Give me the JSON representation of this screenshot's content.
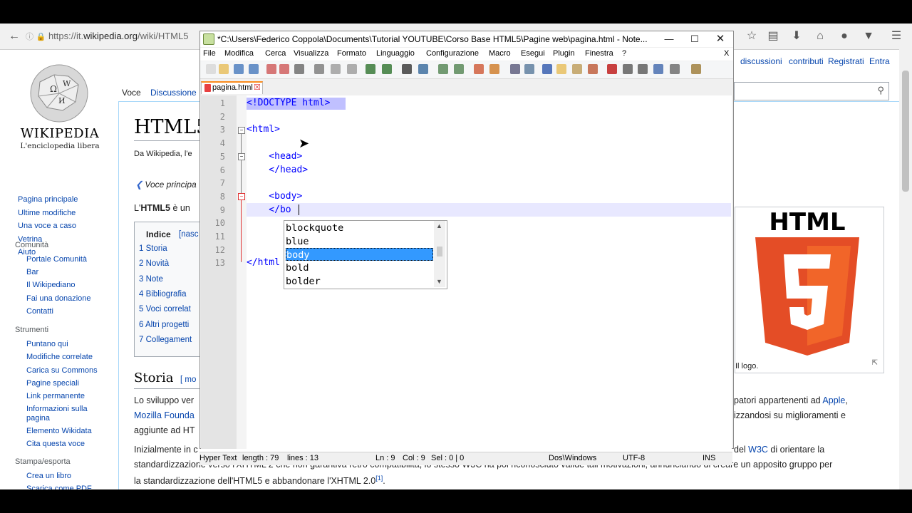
{
  "browser": {
    "url_prefix": "https://it.",
    "url_domain": "wikipedia.org",
    "url_path": "/wiki/HTML5"
  },
  "wiki": {
    "wordmark": "WIKIPEDIA",
    "tagline": "L'enciclopedia libera",
    "tabs": [
      "Voce",
      "Discussione"
    ],
    "right_links": [
      "discussioni",
      "contributi",
      "Registrati",
      "Entra"
    ],
    "title": "HTML5",
    "from": "Da Wikipedia, l'e",
    "hatnote": "Voce principa",
    "lead_start": "L'",
    "lead_bold": "HTML5",
    "lead_rest": " è un",
    "nav": [
      "Pagina principale",
      "Ultime modifiche",
      "Una voce a caso",
      "Vetrina",
      "Aiuto"
    ],
    "community_h": "Comunità",
    "community": [
      "Portale Comunità",
      "Bar",
      "Il Wikipediano",
      "Fai una donazione",
      "Contatti"
    ],
    "tools_h": "Strumenti",
    "tools": [
      "Puntano qui",
      "Modifiche correlate",
      "Carica su Commons",
      "Pagine speciali",
      "Link permanente",
      "Informazioni sulla",
      "pagina",
      "Elemento Wikidata",
      "Cita questa voce"
    ],
    "print_h": "Stampa/esporta",
    "print": [
      "Crea un libro",
      "Scarica come PDF"
    ],
    "toc_title": "Indice",
    "toc_hide": "[nasc",
    "toc": [
      "1  Storia",
      "2  Novità",
      "3  Note",
      "4  Bibliografia",
      "5  Voci correlat",
      "6  Altri progetti",
      "7  Collegament"
    ],
    "section": "Storia",
    "section_edit": "[ mo",
    "p1_a": "Lo sviluppo ver",
    "p1_b": "Mozilla Founda",
    "p1_c": "aggiunte ad HT",
    "p1_r1a": "patori appartenenti ad ",
    "p1_r1b": "Apple",
    "p1_r1c": ",",
    "p1_r2": "izzandosi su miglioramenti e",
    "p2_a": "Inizialmente in c",
    "p2_b": "del ",
    "p2_c": "W3C",
    "p2_d": " di orientare la",
    "p2_line2": "standardizzazione verso l'XHTML 2 che non garantiva retro compatibilità, lo stesso W3C ha poi riconosciuto valide tali motivazioni, annunciando di creare un apposito gruppo per",
    "p2_line3": "la standardizzazione dell'HTML5 e abbandonare l'XHTML 2.0",
    "p2_ref": "[1]",
    "p2_end": ".",
    "logo_text": "HTML",
    "caption": "Il logo."
  },
  "npp": {
    "title": "*C:\\Users\\Federico Coppola\\Documents\\Tutorial YOUTUBE\\Corso Base HTML5\\Pagine web\\pagina.html - Note...",
    "menu": [
      "File",
      "Modifica",
      "Cerca",
      "Visualizza",
      "Formato",
      "Linguaggio",
      "Configurazione",
      "Macro",
      "Esegui",
      "Plugin",
      "Finestra",
      "?"
    ],
    "menu_close": "X",
    "tab": "pagina.html",
    "lines": [
      "<!DOCTYPE html>",
      "",
      "<html>",
      "",
      "    <head>",
      "    </head>",
      "",
      "    <body>",
      "    </bo",
      "",
      "",
      "",
      "</html"
    ],
    "line_numbers": [
      "1",
      "2",
      "3",
      "4",
      "5",
      "6",
      "7",
      "8",
      "9",
      "10",
      "11",
      "12",
      "13"
    ],
    "autocomplete": [
      "blockquote",
      "blue",
      "body",
      "bold",
      "bolder"
    ],
    "autocomplete_selected": "body",
    "status": {
      "type": "Hyper Text",
      "length": "length : 79",
      "lines": "lines : 13",
      "ln": "Ln : 9",
      "col": "Col : 9",
      "sel": "Sel : 0 | 0",
      "eol": "Dos\\Windows",
      "enc": "UTF-8",
      "ins": "INS"
    }
  },
  "colors": {
    "accent_tab": "#fa8b1e",
    "wiki_link": "#0645ad",
    "html5_orange": "#e44d26",
    "selection": "#3399ff"
  }
}
